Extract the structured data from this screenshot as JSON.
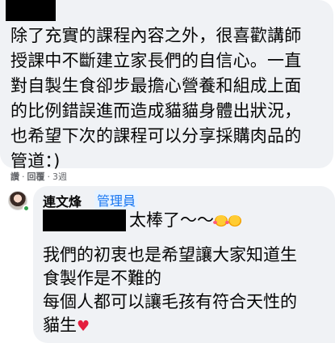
{
  "comment1": {
    "lines": [
      "除了充實的課程內容之外，很喜歡講師",
      "授課中不斷建立家長們的自信心。一直",
      "對自製生食卻步最擔心營養和組成上面",
      "的比例錯誤進而造成貓貓身體出狀況，",
      "也希望下次的課程可以分享採購肉品的",
      "管道：)"
    ],
    "actions": {
      "like": "讚",
      "reply": "回覆",
      "time": "3週"
    }
  },
  "comment2": {
    "author": "連文烽",
    "role": "管理員",
    "first_line": "太棒了～～",
    "emojis": [
      "face-with-hearts-icon",
      "smiling-face-icon"
    ],
    "lines": [
      "我們的初衷也是希望讓大家知道生",
      "食製作是不難的",
      "每個人都可以讓毛孩有符合天性的",
      "貓生"
    ],
    "end_emoji": "red-heart-icon"
  },
  "colors": {
    "bubble": "#f0f2f5",
    "admin_badge": "#1877f2",
    "online": "#31a24c",
    "heart": "#e41e3f"
  }
}
